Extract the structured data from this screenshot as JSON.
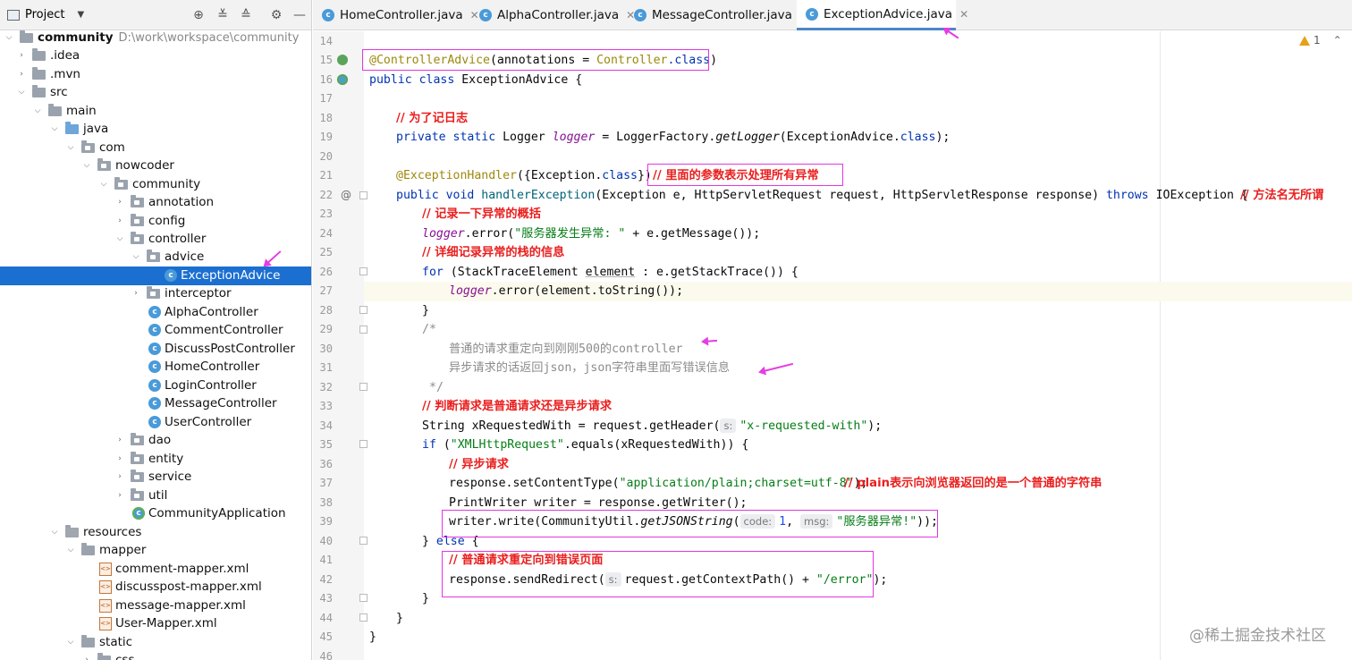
{
  "sidebar": {
    "header_title": "Project",
    "tree": [
      {
        "label": "community",
        "path": "D:\\work\\workspace\\community"
      },
      {
        "label": ".idea"
      },
      {
        "label": ".mvn"
      },
      {
        "label": "src"
      },
      {
        "label": "main"
      },
      {
        "label": "java"
      },
      {
        "label": "com"
      },
      {
        "label": "nowcoder"
      },
      {
        "label": "community"
      },
      {
        "label": "annotation"
      },
      {
        "label": "config"
      },
      {
        "label": "controller"
      },
      {
        "label": "advice"
      },
      {
        "label": "ExceptionAdvice"
      },
      {
        "label": "interceptor"
      },
      {
        "label": "AlphaController"
      },
      {
        "label": "CommentController"
      },
      {
        "label": "DiscussPostController"
      },
      {
        "label": "HomeController"
      },
      {
        "label": "LoginController"
      },
      {
        "label": "MessageController"
      },
      {
        "label": "UserController"
      },
      {
        "label": "dao"
      },
      {
        "label": "entity"
      },
      {
        "label": "service"
      },
      {
        "label": "util"
      },
      {
        "label": "CommunityApplication"
      },
      {
        "label": "resources"
      },
      {
        "label": "mapper"
      },
      {
        "label": "comment-mapper.xml"
      },
      {
        "label": "discusspost-mapper.xml"
      },
      {
        "label": "message-mapper.xml"
      },
      {
        "label": "User-Mapper.xml"
      },
      {
        "label": "static"
      },
      {
        "label": "css"
      }
    ]
  },
  "tabs": [
    {
      "label": "HomeController.java"
    },
    {
      "label": "AlphaController.java"
    },
    {
      "label": "MessageController.java"
    },
    {
      "label": "ExceptionAdvice.java"
    }
  ],
  "warnings": {
    "count": "1"
  },
  "line_numbers": [
    "14",
    "15",
    "16",
    "17",
    "18",
    "19",
    "20",
    "21",
    "22",
    "23",
    "24",
    "25",
    "26",
    "27",
    "28",
    "29",
    "30",
    "31",
    "32",
    "33",
    "34",
    "35",
    "36",
    "37",
    "38",
    "39",
    "40",
    "41",
    "42",
    "43",
    "44",
    "45",
    "46"
  ],
  "code": {
    "l15_ann": "@ControllerAdvice",
    "l15_a": "(annotations = ",
    "l15_b": "Controller",
    "l15_c": ".class",
    "l15_d": ")",
    "l16_kw": "public class",
    "l16_rest": " ExceptionAdvice {",
    "l18_cm": "// 为了记日志",
    "l19_kw": "private static",
    "l19_a": " Logger ",
    "l19_var": "logger",
    "l19_b": " = LoggerFactory.",
    "l19_fn": "getLogger",
    "l19_c": "(ExceptionAdvice.",
    "l19_kw2": "class",
    "l19_d": ");",
    "l21_ann": "@ExceptionHandler",
    "l21_a": "({Exception.",
    "l21_kw": "class",
    "l21_b": "})",
    "l21_cm": "// 里面的参数表示处理所有异常",
    "l22_kw": "public void",
    "l22_fn": " handlerException",
    "l22_a": "(Exception e, HttpServletRequest request, HttpServletResponse response) ",
    "l22_kw2": "throws",
    "l22_b": " IOException {",
    "l22_cm": "// 方法名无所谓",
    "l23_cm": "// 记录一下异常的概括",
    "l24_var": "logger",
    "l24_a": ".error(",
    "l24_str": "\"服务器发生异常: \"",
    "l24_b": " + e.getMessage());",
    "l25_cm": "// 详细记录异常的栈的信息",
    "l26_kw": "for",
    "l26_a": " (StackTraceElement ",
    "l26_var": "element",
    "l26_b": " : e.getStackTrace()) {",
    "l27_var": "logger",
    "l27_a": ".error(element.toString());",
    "l28": "}",
    "l29": "/*",
    "l30": "普通的请求重定向到刚刚500的controller",
    "l31": "异步请求的话返回json，json字符串里面写错误信息",
    "l32": "*/",
    "l33_cm": "// 判断请求是普通请求还是异步请求",
    "l34_a": "String xRequestedWith = request.getHeader(",
    "l34_hint": "s:",
    "l34_str": "\"x-requested-with\"",
    "l34_b": ");",
    "l35_kw": "if",
    "l35_a": " (",
    "l35_str": "\"XMLHttpRequest\"",
    "l35_b": ".equals(xRequestedWith)) {",
    "l36_cm": "// 异步请求",
    "l37_a": "response.setContentType(",
    "l37_str": "\"application/plain;charset=utf-8\"",
    "l37_b": ");",
    "l37_cm": "// plain表示向浏览器返回的是一个普通的字符串",
    "l38_a": "PrintWriter writer = response.getWriter();",
    "l39_a": "writer.write(CommunityUtil.",
    "l39_fn": "getJSONString",
    "l39_b": "(",
    "l39_hint1": "code:",
    "l39_num": "1",
    "l39_c": ", ",
    "l39_hint2": "msg:",
    "l39_str": "\"服务器异常!\"",
    "l39_d": "));",
    "l40_a": "} ",
    "l40_kw": "else",
    "l40_b": " {",
    "l41_cm": "// 普通请求重定向到错误页面",
    "l42_a": "response.sendRedirect(",
    "l42_hint": "s:",
    "l42_b": "request.getContextPath() + ",
    "l42_str": "\"/error\"",
    "l42_c": ");",
    "l43": "}",
    "l44": "}",
    "l45": "}"
  },
  "watermark": "@稀土掘金技术社区"
}
